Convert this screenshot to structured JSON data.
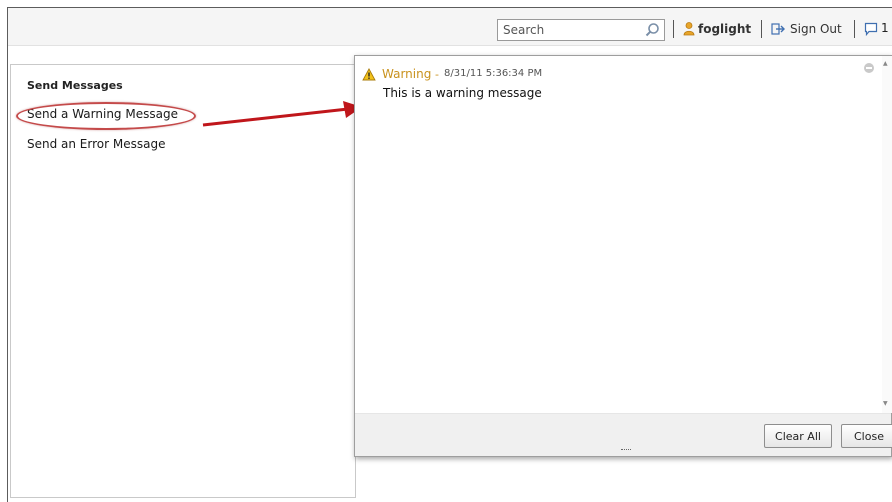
{
  "header": {
    "search_placeholder": "Search",
    "user_name": "foglight",
    "sign_out_label": "Sign Out",
    "message_count": "1"
  },
  "panel": {
    "title": "Send Messages",
    "links": [
      "Send a Warning Message",
      "Send an Error Message"
    ]
  },
  "notification": {
    "level": "Warning",
    "separator": "-",
    "timestamp": "8/31/11 5:36:34 PM",
    "text": "This is a warning message",
    "clear_all_label": "Clear All",
    "close_label": "Close"
  },
  "colors": {
    "warning_text": "#c9921e",
    "highlight": "#c44a4a",
    "arrow": "#c0161b"
  },
  "icons": [
    "search-icon",
    "user-icon",
    "sign-out-icon",
    "message-icon",
    "warning-icon",
    "dismiss-icon"
  ]
}
